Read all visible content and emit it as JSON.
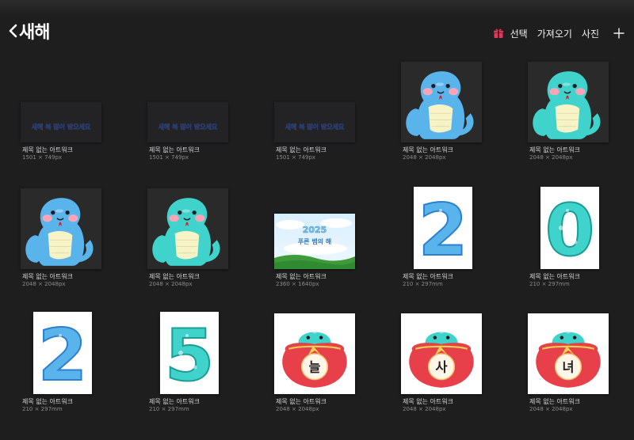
{
  "header": {
    "title": "새해",
    "actions": {
      "select": "선택",
      "import": "가져오기",
      "photo": "사진"
    }
  },
  "colors": {
    "background": "#1e1e1e",
    "gift": "#e8335a",
    "snake": "#3fd3cc",
    "snake_blue": "#5ab4ec",
    "pot": "#e8404a"
  },
  "artworks": [
    {
      "name": "제목 없는 아트워크",
      "dims": "1501 × 749px",
      "kind": "banner",
      "text": "새해 복 많이 받으세요"
    },
    {
      "name": "제목 없는 아트워크",
      "dims": "1501 × 749px",
      "kind": "banner",
      "text": "새해 복 많이 받으세요"
    },
    {
      "name": "제목 없는 아트워크",
      "dims": "1501 × 749px",
      "kind": "banner",
      "text": "새해 복 많이 받으세요"
    },
    {
      "name": "제목 없는 아트워크",
      "dims": "2048 × 2048px",
      "kind": "snake",
      "palette": "blue"
    },
    {
      "name": "제목 없는 아트워크",
      "dims": "2048 × 2048px",
      "kind": "snake",
      "palette": "teal"
    },
    {
      "name": "제목 없는 아트워크",
      "dims": "2048 × 2048px",
      "kind": "snake",
      "palette": "blue"
    },
    {
      "name": "제목 없는 아트워크",
      "dims": "2048 × 2048px",
      "kind": "snake",
      "palette": "teal"
    },
    {
      "name": "제목 없는 아트워크",
      "dims": "2360 × 1640px",
      "kind": "landscape",
      "text": "푸른 뱀의 해"
    },
    {
      "name": "제목 없는 아트워크",
      "dims": "210 × 297mm",
      "kind": "digit",
      "text": "2",
      "palette": "blue"
    },
    {
      "name": "제목 없는 아트워크",
      "dims": "210 × 297mm",
      "kind": "digit",
      "text": "0",
      "palette": "teal"
    },
    {
      "name": "제목 없는 아트워크",
      "dims": "210 × 297mm",
      "kind": "digit",
      "text": "2",
      "palette": "blue"
    },
    {
      "name": "제목 없는 아트워크",
      "dims": "210 × 297mm",
      "kind": "digit",
      "text": "5",
      "palette": "teal"
    },
    {
      "name": "제목 없는 아트워크",
      "dims": "2048 × 2048px",
      "kind": "pot",
      "text": "늘"
    },
    {
      "name": "제목 없는 아트워크",
      "dims": "2048 × 2048px",
      "kind": "pot",
      "text": "사"
    },
    {
      "name": "제목 없는 아트워크",
      "dims": "2048 × 2048px",
      "kind": "pot",
      "text": "녀"
    }
  ]
}
